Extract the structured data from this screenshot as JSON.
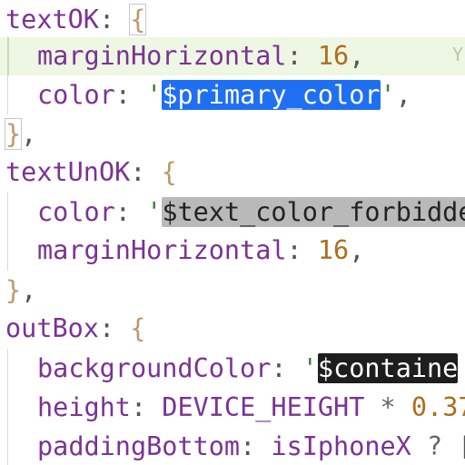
{
  "editor": {
    "fold_glyph": "Y",
    "lines": [
      {
        "key": "textOK",
        "colon": ":",
        "brace": "{"
      },
      {
        "prop": "marginHorizontal",
        "colon": ":",
        "value": "16",
        "comma": ","
      },
      {
        "prop": "color",
        "colon": ":",
        "quote_open": "'",
        "selected": "$primary_color",
        "quote_close": "'",
        "comma": ","
      },
      {
        "close": "}",
        "comma": ","
      },
      {
        "key": "textUnOK",
        "colon": ":",
        "brace": "{"
      },
      {
        "prop": "color",
        "colon": ":",
        "quote_open": "'",
        "selected": "$text_color_forbidde"
      },
      {
        "prop": "marginHorizontal",
        "colon": ":",
        "value": "16",
        "comma": ","
      },
      {
        "close": "}",
        "comma": ","
      },
      {
        "key": "outBox",
        "colon": ":",
        "brace": "{"
      },
      {
        "prop": "backgroundColor",
        "colon": ":",
        "quote_open": "'",
        "selected": "$containe"
      },
      {
        "prop": "height",
        "colon": ":",
        "ident": "DEVICE_HEIGHT",
        "op": "*",
        "value": "0.37"
      },
      {
        "prop": "paddingBottom",
        "colon": ":",
        "ident": "isIphoneX",
        "op": "?",
        "tail": "["
      }
    ]
  }
}
